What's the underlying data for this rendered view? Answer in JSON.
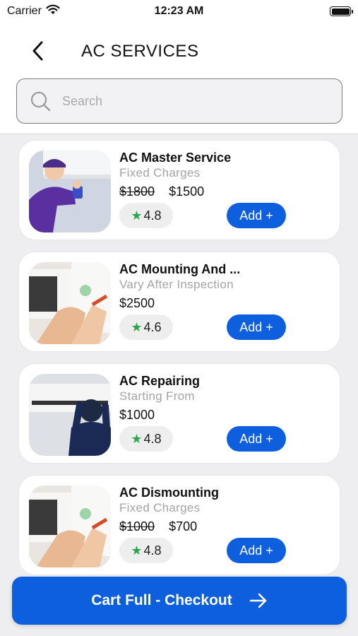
{
  "status_bar": {
    "carrier": "Carrier",
    "time": "12:23 AM"
  },
  "header": {
    "title": "AC SERVICES",
    "back_icon": "chevron-left-icon"
  },
  "search": {
    "placeholder": "Search",
    "value": ""
  },
  "services": [
    {
      "title": "AC Master Service",
      "subtitle": "Fixed Charges",
      "old_price": "$1800",
      "price": "$1500",
      "rating": "4.8",
      "add_label": "Add +"
    },
    {
      "title": "AC Mounting And ...",
      "subtitle": "Vary After Inspection",
      "old_price": "",
      "price": "$2500",
      "rating": "4.6",
      "add_label": "Add +"
    },
    {
      "title": "AC Repairing",
      "subtitle": "Starting From",
      "old_price": "",
      "price": "$1000",
      "rating": "4.8",
      "add_label": "Add +"
    },
    {
      "title": "AC Dismounting",
      "subtitle": "Fixed Charges",
      "old_price": "$1000",
      "price": "$700",
      "rating": "4.8",
      "add_label": "Add +"
    }
  ],
  "checkout": {
    "label": "Cart Full - Checkout",
    "icon": "arrow-right-icon"
  },
  "colors": {
    "accent": "#0e5fde",
    "star": "#2aa84a",
    "background": "#eeeef0"
  }
}
